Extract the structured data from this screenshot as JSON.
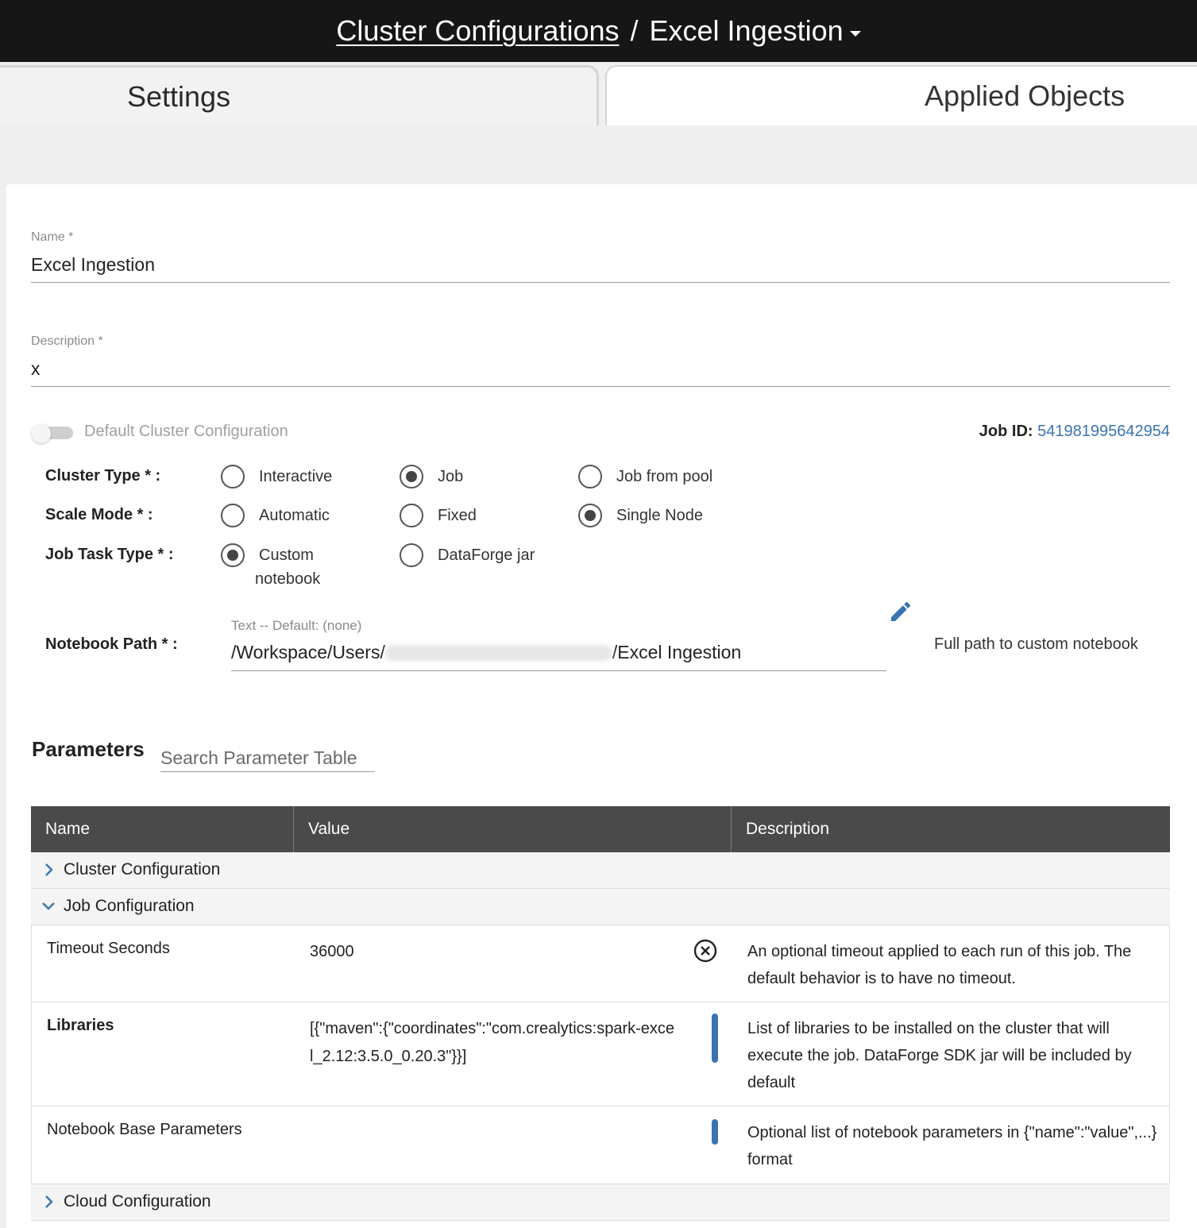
{
  "header": {
    "breadcrumb_link": "Cluster Configurations",
    "separator": "/",
    "current": "Excel Ingestion"
  },
  "tabs": [
    {
      "label": "Settings",
      "active": true
    },
    {
      "label": "Applied Objects",
      "active": false
    }
  ],
  "form": {
    "name": {
      "label": "Name *",
      "value": "Excel Ingestion"
    },
    "description": {
      "label": "Description *",
      "value": "x"
    },
    "default_toggle": {
      "label": "Default Cluster Configuration",
      "on": false
    },
    "job_id": {
      "label": "Job ID:",
      "value": "541981995642954"
    },
    "cluster_type": {
      "label": "Cluster Type * :",
      "options": [
        "Interactive",
        "Job",
        "Job from pool"
      ],
      "selected": "Job"
    },
    "scale_mode": {
      "label": "Scale Mode * :",
      "options": [
        "Automatic",
        "Fixed",
        "Single Node"
      ],
      "selected": "Single Node"
    },
    "job_task_type": {
      "label": "Job Task Type * :",
      "options": [
        "Custom notebook",
        "DataForge jar"
      ],
      "option_lines": [
        "Custom",
        "notebook"
      ],
      "selected": "Custom notebook"
    },
    "notebook_path": {
      "label": "Notebook Path * :",
      "hint": "Text -- Default: (none)",
      "value_prefix": "/Workspace/Users/",
      "value_suffix": "/Excel Ingestion",
      "help": "Full path to custom notebook"
    }
  },
  "parameters": {
    "title": "Parameters",
    "search_placeholder": "Search Parameter Table",
    "columns": [
      "Name",
      "Value",
      "Description"
    ],
    "groups": [
      {
        "label": "Cluster Configuration",
        "expanded": false
      },
      {
        "label": "Job Configuration",
        "expanded": true
      },
      {
        "label": "Cloud Configuration",
        "expanded": false
      }
    ],
    "rows": [
      {
        "name": "Timeout Seconds",
        "value": "36000",
        "description": "An optional timeout applied to each run of this job. The default behavior is to have no timeout."
      },
      {
        "name": "Libraries",
        "value": "[{\"maven\":{\"coordinates\":\"com.crealytics:spark-excel_2.12:3.5.0_0.20.3\"}}]",
        "description": "List of libraries to be installed on the cluster that will execute the job. DataForge SDK jar will be included by default"
      },
      {
        "name": "Notebook Base Parameters",
        "value": "",
        "description": "Optional list of notebook parameters in {\"name\":\"value\",...} format"
      }
    ]
  },
  "colors": {
    "header_bg": "#161616",
    "table_header_bg": "#4a4a4a",
    "accent": "#3a74b0"
  }
}
